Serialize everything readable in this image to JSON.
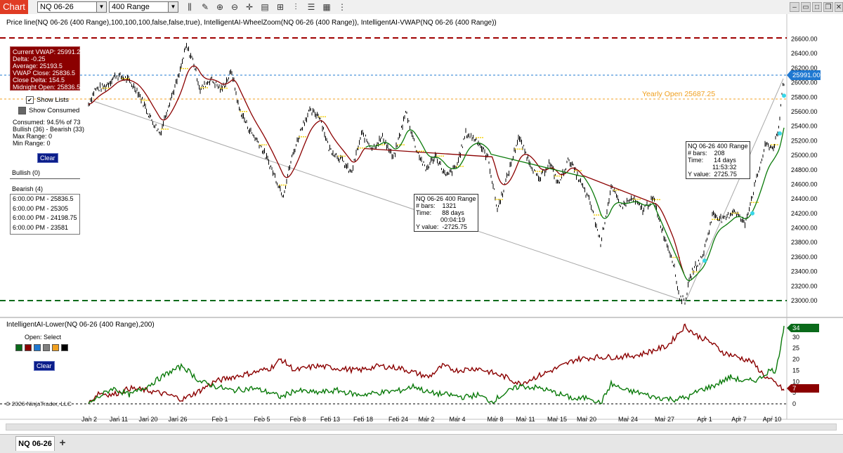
{
  "toolbar": {
    "chart_label": "Chart",
    "instrument": "NQ 06-26",
    "bar_type": "400 Range",
    "icons": [
      "bar-style-icon",
      "draw-pencil-icon",
      "zoom-in-icon",
      "zoom-out-icon",
      "crosshair-icon",
      "data-box-icon",
      "strategies-icon",
      "indicators-icon",
      "properties-icon",
      "templates-icon",
      "more-icon"
    ],
    "window_icons": [
      "minimize-icon",
      "restore-icon",
      "maximize-icon",
      "close-icon"
    ]
  },
  "price_panel": {
    "title": "Price line(NQ 06-26 (400 Range),100,100,100,false,false,true), IntelligentAI-WheelZoom(NQ 06-26 (400 Range)), IntelligentAI-VWAP(NQ 06-26 (400 Range))",
    "y_ticks": [
      "26600.00",
      "26400.00",
      "26200.00",
      "26000.00",
      "25800.00",
      "25600.00",
      "25400.00",
      "25200.00",
      "25000.00",
      "24800.00",
      "24600.00",
      "24400.00",
      "24200.00",
      "24000.00",
      "23800.00",
      "23600.00",
      "23400.00",
      "23200.00",
      "23000.00"
    ],
    "current_price": "25991.00",
    "yearly_open_label": "Yearly Open  25687.25",
    "colors": {
      "bar": "#000000",
      "vwap_red": "#8b0000",
      "vwap_green": "#0a7a0a",
      "blue_line": "#1f78d1",
      "orange_line": "#f0a020",
      "red_dashed": "#a00000",
      "green_dashed": "#0a6a1a",
      "cyan_marker": "#3ad7e8",
      "yellow_mark": "#f2d21a"
    }
  },
  "vwap_box": {
    "lines": [
      "Current VWAP: 25991.25",
      "Delta: -0.25",
      "Average: 25193.5",
      "VWAP Close: 25836.5",
      "Close Delta: 154.5",
      "Midnight Open: 25836.5"
    ]
  },
  "sidebar": {
    "show_lists": "Show Lists",
    "show_consumed": "Show Consumed",
    "consumed": "Consumed: 94.5% of 73",
    "bull_bear": "Bullish (36) - Bearish (33)",
    "max_range": "Max Range: 0",
    "min_range": "Min Range: 0",
    "clear": "Clear",
    "bullish_head": "Bullish (0)",
    "bearish_head": "Bearish (4)",
    "bearish_items": [
      "6:00.00 PM - 25836.5",
      "6:00.00 PM - 25305",
      "6:00.00 PM - 24198.75",
      "6:00.00 PM - 23581"
    ]
  },
  "tooltips": {
    "left": {
      "l1": "NQ 06-26 400 Range",
      "l2": "# bars:    1321",
      "l3": "Time:      88 days",
      "l4": "              00:04:19",
      "l5": "Y value:  -2725.75"
    },
    "right": {
      "l1": "NQ 06-26 400 Range",
      "l2": "# bars:    208",
      "l3": "Time:      14 days",
      "l4": "              11:53:32",
      "l5": "Y value:  2725.75"
    }
  },
  "lower_panel": {
    "title": "IntelligentAI-Lower(NQ 06-26 (400 Range),200)",
    "open_select": "Open:  Select",
    "swatches": [
      "#0a6a1a",
      "#8b0000",
      "#1f78d1",
      "#808080",
      "#f0a020",
      "#000000"
    ],
    "clear": "Clear",
    "y_ticks": [
      "30",
      "25",
      "20",
      "15",
      "10",
      "5",
      "0"
    ],
    "green_value": "34",
    "red_value": "7",
    "copyright": "© 2026 NinjaTrader, LLC"
  },
  "x_axis": {
    "labels": [
      "Jan 2",
      "Jan 11",
      "Jan 20",
      "Jan 26",
      "Feb 1",
      "Feb 5",
      "Feb 8",
      "Feb 13",
      "Feb 18",
      "Feb 24",
      "Mar 2",
      "Mar 4",
      "Mar 8",
      "Mar 11",
      "Mar 15",
      "Mar 20",
      "Mar 24",
      "Mar 27",
      "Apr 1",
      "Apr 7",
      "Apr 10"
    ]
  },
  "tabs": {
    "active": "NQ 06-26",
    "add": "+"
  }
}
